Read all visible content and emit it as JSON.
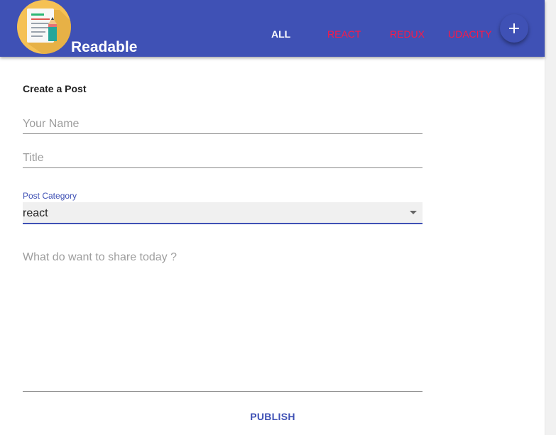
{
  "header": {
    "app_title": "Readable",
    "nav_links": [
      {
        "label": "ALL",
        "active": true
      },
      {
        "label": "REACT",
        "active": false
      },
      {
        "label": "REDUX",
        "active": false
      },
      {
        "label": "UDACITY",
        "active": false
      }
    ],
    "fab_icon": "plus-icon",
    "logo_icon": "document-pencil-icon"
  },
  "form": {
    "title": "Create a Post",
    "name_placeholder": "Your Name",
    "name_value": "",
    "title_placeholder": "Title",
    "title_value": "",
    "category_label": "Post Category",
    "category_value": "react",
    "body_placeholder": "What do want to share today ?",
    "body_value": "",
    "publish_label": "PUBLISH"
  },
  "colors": {
    "primary": "#3f51b5",
    "accent": "#ff1744",
    "logo_background": "#f5c155"
  }
}
